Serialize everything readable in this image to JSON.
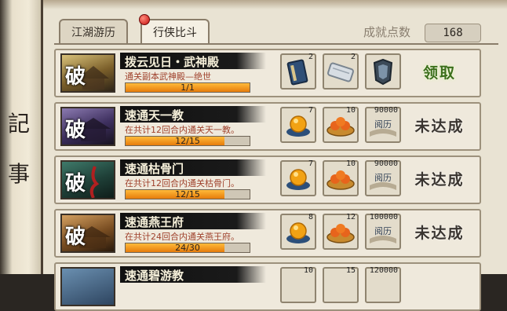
{
  "left_scroll": {
    "glyphs": [
      "記",
      "事"
    ]
  },
  "tabs": [
    {
      "label": "江湖游历",
      "active": false
    },
    {
      "label": "行侠比斗",
      "active": true,
      "has_badge": true
    }
  ],
  "points": {
    "label": "成就点数",
    "value": "168"
  },
  "colors": {
    "accent_orange": "#f0951e",
    "claim_green": "#3b6e1a",
    "desc_red": "#a0422d"
  },
  "achievements": [
    {
      "title": "拨云见日・武神殿",
      "description": "通关副本武神殿—绝世",
      "progress_text": "1/1",
      "progress": 1.0,
      "status": "领取",
      "rewards": [
        {
          "icon": "book-icon",
          "count": "2"
        },
        {
          "icon": "scroll-icon",
          "count": "2"
        },
        {
          "icon": "armor-icon",
          "count": ""
        }
      ]
    },
    {
      "title": "速通天一教",
      "description": "在共计12回合内通关天一教。",
      "progress_text": "12/15",
      "progress": 0.8,
      "status": "未达成",
      "rewards": [
        {
          "icon": "orb-icon",
          "count": "7"
        },
        {
          "icon": "fruit-plate-icon",
          "count": "10"
        },
        {
          "icon": "reputation-book-icon",
          "count": "90000"
        }
      ]
    },
    {
      "title": "速通枯骨门",
      "description": "在共计12回合内通关枯骨门。",
      "progress_text": "12/15",
      "progress": 0.8,
      "status": "未达成",
      "rewards": [
        {
          "icon": "orb-icon",
          "count": "7"
        },
        {
          "icon": "fruit-plate-icon",
          "count": "10"
        },
        {
          "icon": "reputation-book-icon",
          "count": "90000"
        }
      ]
    },
    {
      "title": "速通燕王府",
      "description": "在共计24回合内通关燕王府。",
      "progress_text": "24/30",
      "progress": 0.8,
      "status": "未达成",
      "rewards": [
        {
          "icon": "orb-icon",
          "count": "8"
        },
        {
          "icon": "fruit-plate-icon",
          "count": "12"
        },
        {
          "icon": "reputation-book-icon",
          "count": "100000"
        }
      ]
    },
    {
      "title": "速通碧游教",
      "description": "",
      "progress_text": "",
      "progress": 0,
      "status": "",
      "rewards": [
        {
          "icon": "orb-icon",
          "count": "10"
        },
        {
          "icon": "fruit-plate-icon",
          "count": "15"
        },
        {
          "icon": "reputation-book-icon",
          "count": "120000"
        }
      ]
    }
  ],
  "thumb_glyph": "破",
  "reward_book_text": "阅历"
}
